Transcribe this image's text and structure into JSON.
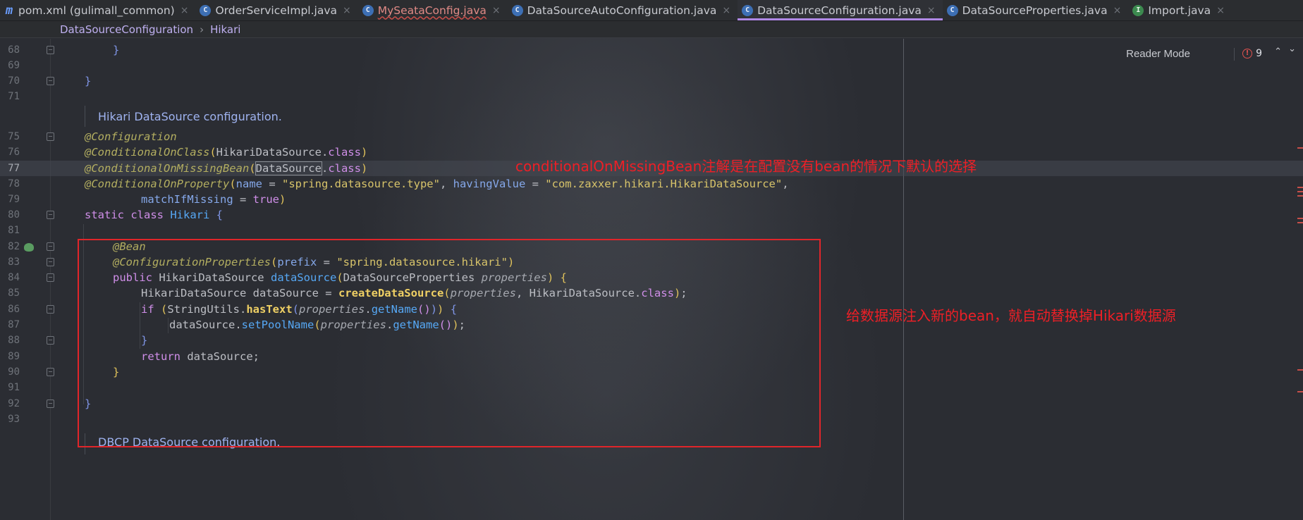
{
  "tabs": [
    {
      "icon": "m",
      "label": "pom.xml (gulimall_common)",
      "close": "×",
      "warn": false,
      "active": false
    },
    {
      "icon": "c",
      "label": "OrderServiceImpl.java",
      "close": "×",
      "warn": false,
      "active": false
    },
    {
      "icon": "c",
      "label": "MySeataConfig.java",
      "close": "×",
      "warn": true,
      "active": false
    },
    {
      "icon": "c",
      "label": "DataSourceAutoConfiguration.java",
      "close": "×",
      "warn": false,
      "active": false
    },
    {
      "icon": "c",
      "label": "DataSourceConfiguration.java",
      "close": "×",
      "warn": false,
      "active": true
    },
    {
      "icon": "c",
      "label": "DataSourceProperties.java",
      "close": "×",
      "warn": false,
      "active": false
    },
    {
      "icon": "i",
      "label": "Import.java",
      "close": "×",
      "warn": false,
      "active": false
    }
  ],
  "breadcrumb": {
    "file": "DataSourceConfiguration",
    "sep": "›",
    "member": "Hikari"
  },
  "editor": {
    "reader_mode": "Reader Mode",
    "error_count": "9",
    "error_badge": "!",
    "up_chevron": "⌃",
    "down_chevron": "⌄",
    "doc_hikari": "Hikari DataSource configuration.",
    "doc_dbcp": "DBCP DataSource configuration.",
    "line_numbers": [
      "68",
      "69",
      "70",
      "71",
      "75",
      "76",
      "77",
      "78",
      "79",
      "80",
      "81",
      "82",
      "83",
      "84",
      "85",
      "86",
      "87",
      "88",
      "89",
      "90",
      "91",
      "92",
      "93"
    ],
    "current_line": "77"
  },
  "annotations": {
    "note_missing_bean": "conditionalOnMissingBean注解是在配置没有bean的情况下默认的选择",
    "note_inject": "给数据源注入新的bean，就自动替换掉Hikari数据源"
  },
  "colors": {
    "red_annotation": "#ee1f26",
    "active_tab_underline": "#b089e6",
    "background": "#2b2d33"
  }
}
